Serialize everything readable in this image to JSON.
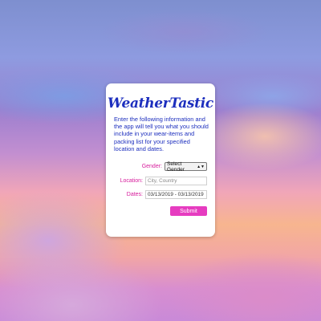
{
  "app": {
    "brand": "WeatherTastic",
    "intro": "Enter the following information and the app will tell you what you should include in your wear-items and packing list for your specified location and dates."
  },
  "form": {
    "gender_label": "Gender:",
    "gender_selected": "Select Gender",
    "location_label": "Location:",
    "location_placeholder": "City, Country",
    "dates_label": "Dates:",
    "dates_value": "03/13/2019 - 03/13/2019",
    "submit_label": "Submit"
  },
  "colors": {
    "brand_blue": "#1d2fbe",
    "label_pink": "#d61c9c",
    "button_magenta": "#e63cc0"
  },
  "icons": {
    "select_arrow": "chevron-up-down-icon"
  }
}
